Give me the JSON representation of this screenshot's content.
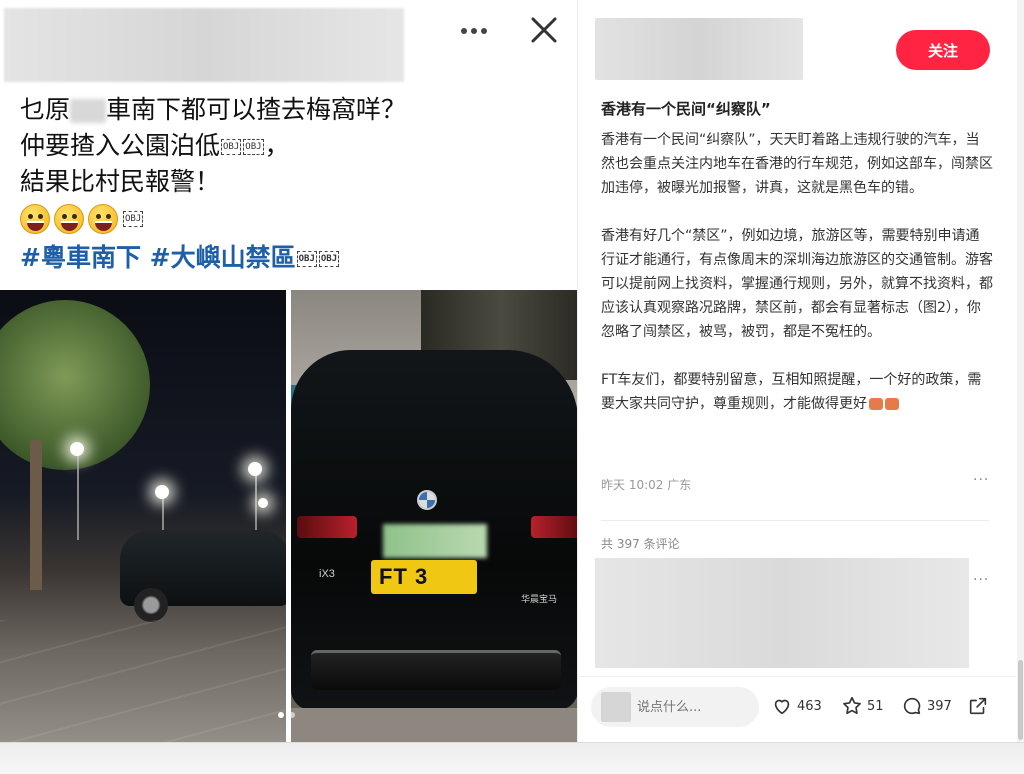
{
  "image_panel": {
    "caption_lines": [
      "乜原",
      "車南下都可以揸去梅窩咩？",
      "仲要揸入公園泊低",
      "，",
      "結果比村民報警！"
    ],
    "obj_glyph": "OBJ",
    "hashtags": "#粵車南下 #大嶼山禁區",
    "plate_text": "FT 3",
    "model_badge": "iX3",
    "brand_badge": "华晨宝马",
    "more_icon": "more-horizontal-icon",
    "close_icon": "close-icon"
  },
  "post": {
    "follow_label": "关注",
    "title": "香港有一个民间“纠察队”",
    "paragraphs": [
      "香港有一个民间“纠察队”，天天盯着路上违规行驶的汽车，当然也会重点关注内地车在香港的行车规范，例如这部车，闯禁区加违停，被曝光加报警，讲真，这就是黑色车的错。",
      "香港有好几个“禁区”，例如边境，旅游区等，需要特别申请通行证才能通行，有点像周末的深圳海边旅游区的交通管制。游客可以提前网上找资料，掌握通行规则，另外，就算不找资料，都应该认真观察路况路牌，禁区前，都会有显著标志（图2），你忽略了闯禁区，被骂，被罚，都是不冤枉的。",
      "FT车友们，都要特别留意，互相知照提醒，一个好的政策，需要大家共同守护，尊重规则，才能做得更好"
    ],
    "meta": "昨天 10:02 广东",
    "more": "···",
    "comment_count": "共 397 条评论",
    "comment_more": "···"
  },
  "bottom_bar": {
    "comment_placeholder": "说点什么...",
    "likes": "463",
    "stars": "51",
    "comments": "397"
  },
  "colors": {
    "accent": "#ff2442",
    "hashtag": "#1f5fa8"
  }
}
